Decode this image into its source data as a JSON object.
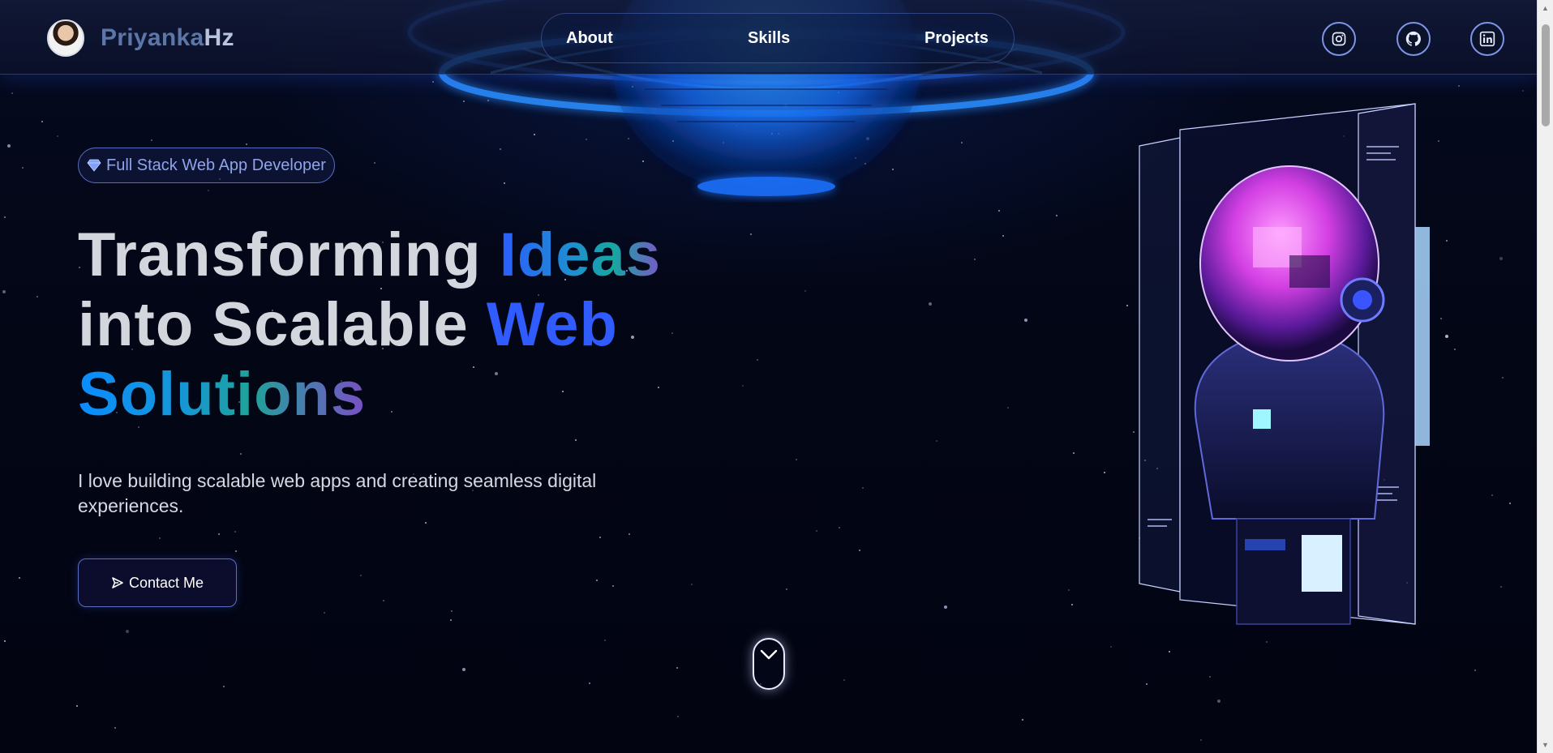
{
  "brand": {
    "first": "Priyanka",
    "last": "Hz",
    "avatar_icon": "profile-photo"
  },
  "nav": {
    "items": [
      "About",
      "Skills",
      "Projects"
    ]
  },
  "social": [
    {
      "name": "instagram",
      "icon": "instagram-icon"
    },
    {
      "name": "github",
      "icon": "github-icon"
    },
    {
      "name": "linkedin",
      "icon": "linkedin-icon"
    }
  ],
  "hero": {
    "badge": {
      "icon": "gem-icon",
      "text": "Full Stack Web App Developer"
    },
    "headline": {
      "line1_plain": "Transforming ",
      "line1_accent": "Ideas",
      "line2_plain": "into Scalable ",
      "line2_accent": "Web",
      "line3_accent": "Solutions"
    },
    "subtext": "I love building scalable web apps and creating seamless digital experiences.",
    "cta": {
      "icon": "send-icon",
      "label": "Contact Me"
    },
    "scroll_icon": "chevron-down-icon"
  },
  "colors": {
    "background": "#030615",
    "accent_blue": "#2f5bff",
    "accent_teal": "#15a8a0",
    "accent_purple": "#7a57c8",
    "badge_text": "#8fa4ea"
  }
}
